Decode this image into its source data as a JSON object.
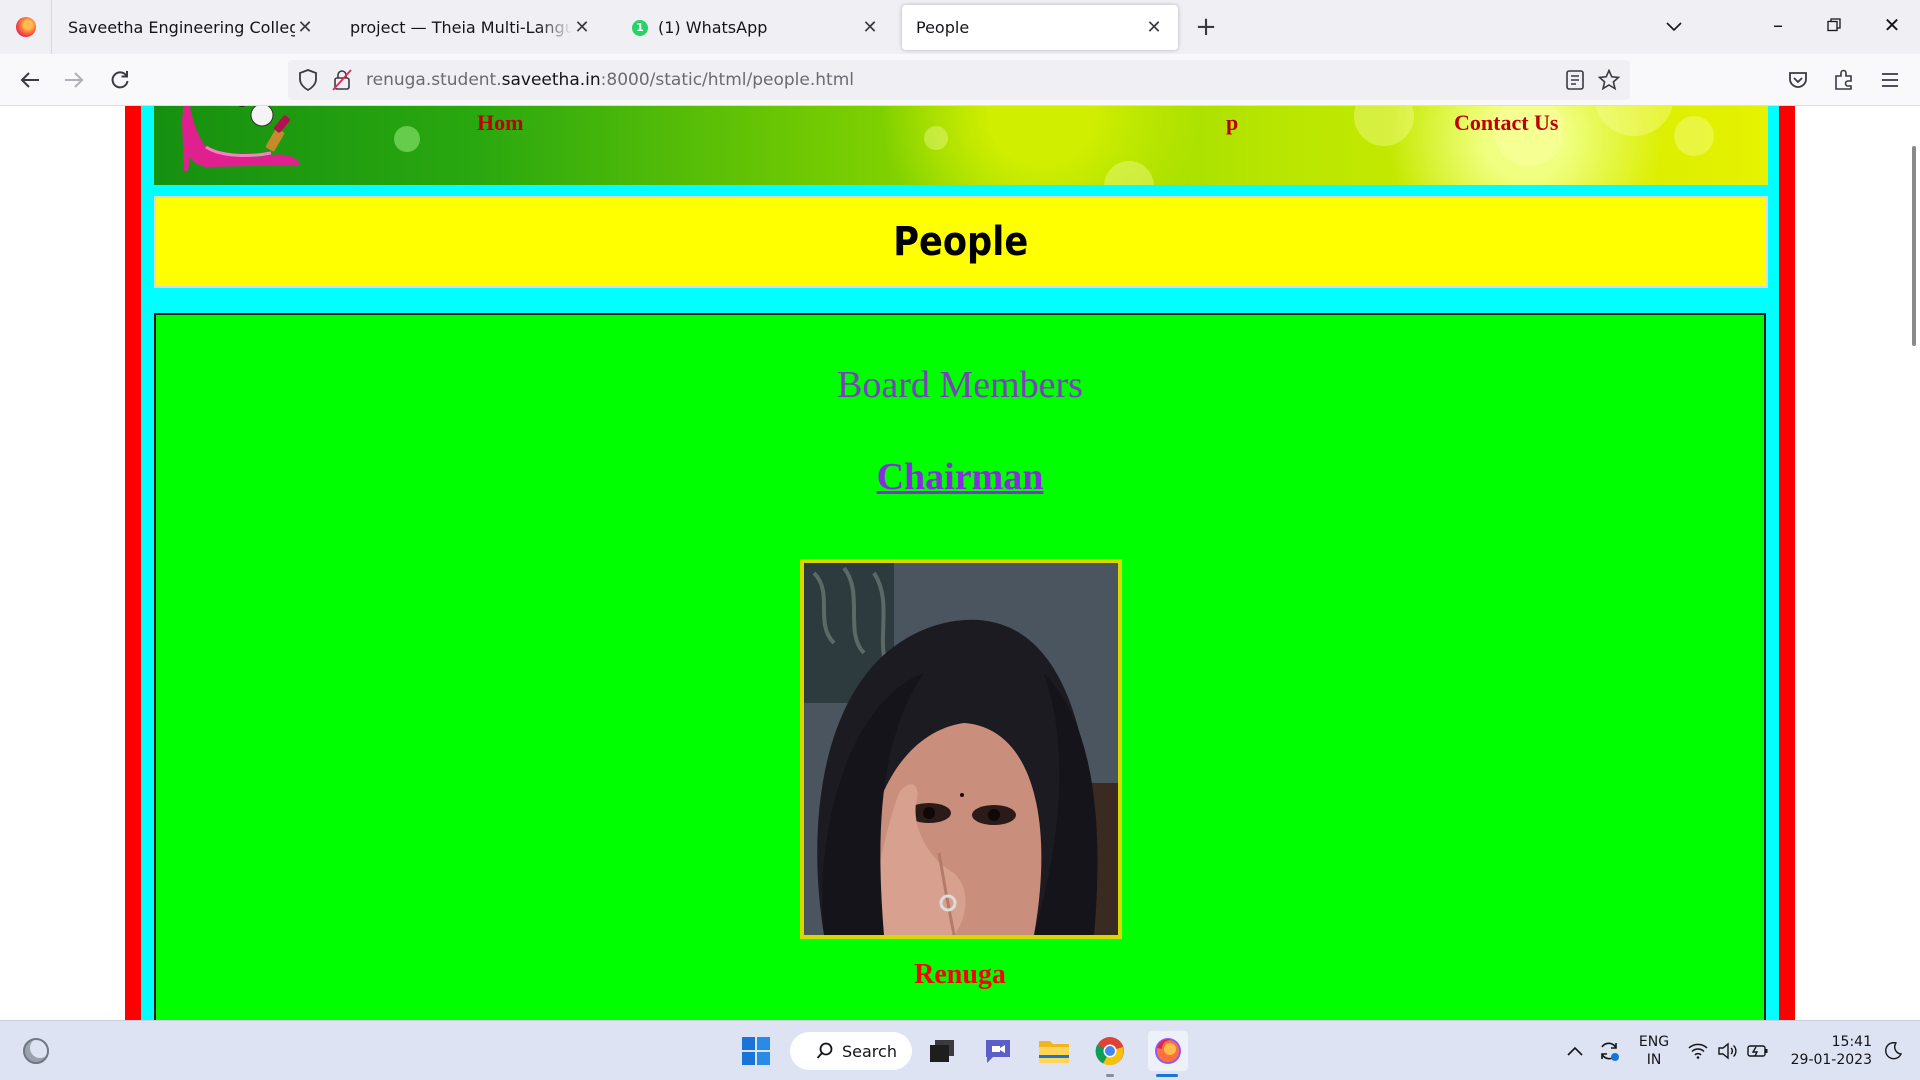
{
  "browser": {
    "tabs": [
      {
        "title": "Saveetha Engineering College",
        "active": false
      },
      {
        "title": "project — Theia Multi-Language Ex",
        "active": false
      },
      {
        "title": "(1) WhatsApp",
        "active": false,
        "badge": "1"
      },
      {
        "title": "People",
        "active": true
      }
    ],
    "url": {
      "prefix": "renuga.student.",
      "domain": "saveetha.in",
      "suffix": ":8000/static/html/people.html"
    }
  },
  "page": {
    "nav_links": {
      "left": "Hom",
      "mid": "p",
      "contact": "Contact Us"
    },
    "heading": "People",
    "section_title": "Board Members",
    "chairman_link": "Chairman",
    "member_name": "Renuga"
  },
  "taskbar": {
    "search_label": "Search",
    "lang_top": "ENG",
    "lang_bottom": "IN",
    "time": "15:41",
    "date": "29-01-2023"
  },
  "colors": {
    "outer_frame": "#ff0000",
    "inner_frame": "#00ffff",
    "heading_bg": "#ffff00",
    "content_bg": "#00ff00",
    "section_title": "#7b3fbf",
    "link": "#8a2be2",
    "name": "#ff0000"
  }
}
